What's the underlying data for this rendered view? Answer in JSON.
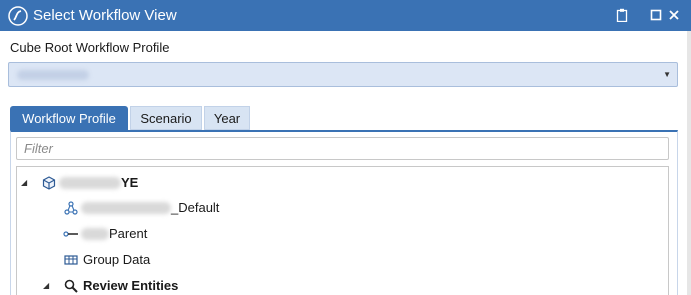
{
  "window": {
    "title": "Select Workflow View",
    "logo_icon": "onestream-logo-icon",
    "controls": [
      "clipboard-icon",
      "maximize-icon",
      "close-icon"
    ],
    "accent": "#3a72b4"
  },
  "profile": {
    "label": "Cube Root Workflow Profile",
    "selected_value": ""
  },
  "tabs": [
    {
      "label": "Workflow Profile",
      "active": true
    },
    {
      "label": "Scenario",
      "active": false
    },
    {
      "label": "Year",
      "active": false
    }
  ],
  "filter": {
    "placeholder": "Filter",
    "value": ""
  },
  "tree": {
    "root": {
      "label": "YE",
      "icon": "cube-icon",
      "expanded": true
    },
    "children": [
      {
        "label": "_Default",
        "icon": "workflow-icon"
      },
      {
        "label": "Parent",
        "icon": "parent-icon"
      },
      {
        "label": "Group Data",
        "icon": "data-grid-icon"
      }
    ],
    "review": {
      "label": "Review Entities",
      "icon": "magnifier-icon",
      "expanded": true
    }
  }
}
